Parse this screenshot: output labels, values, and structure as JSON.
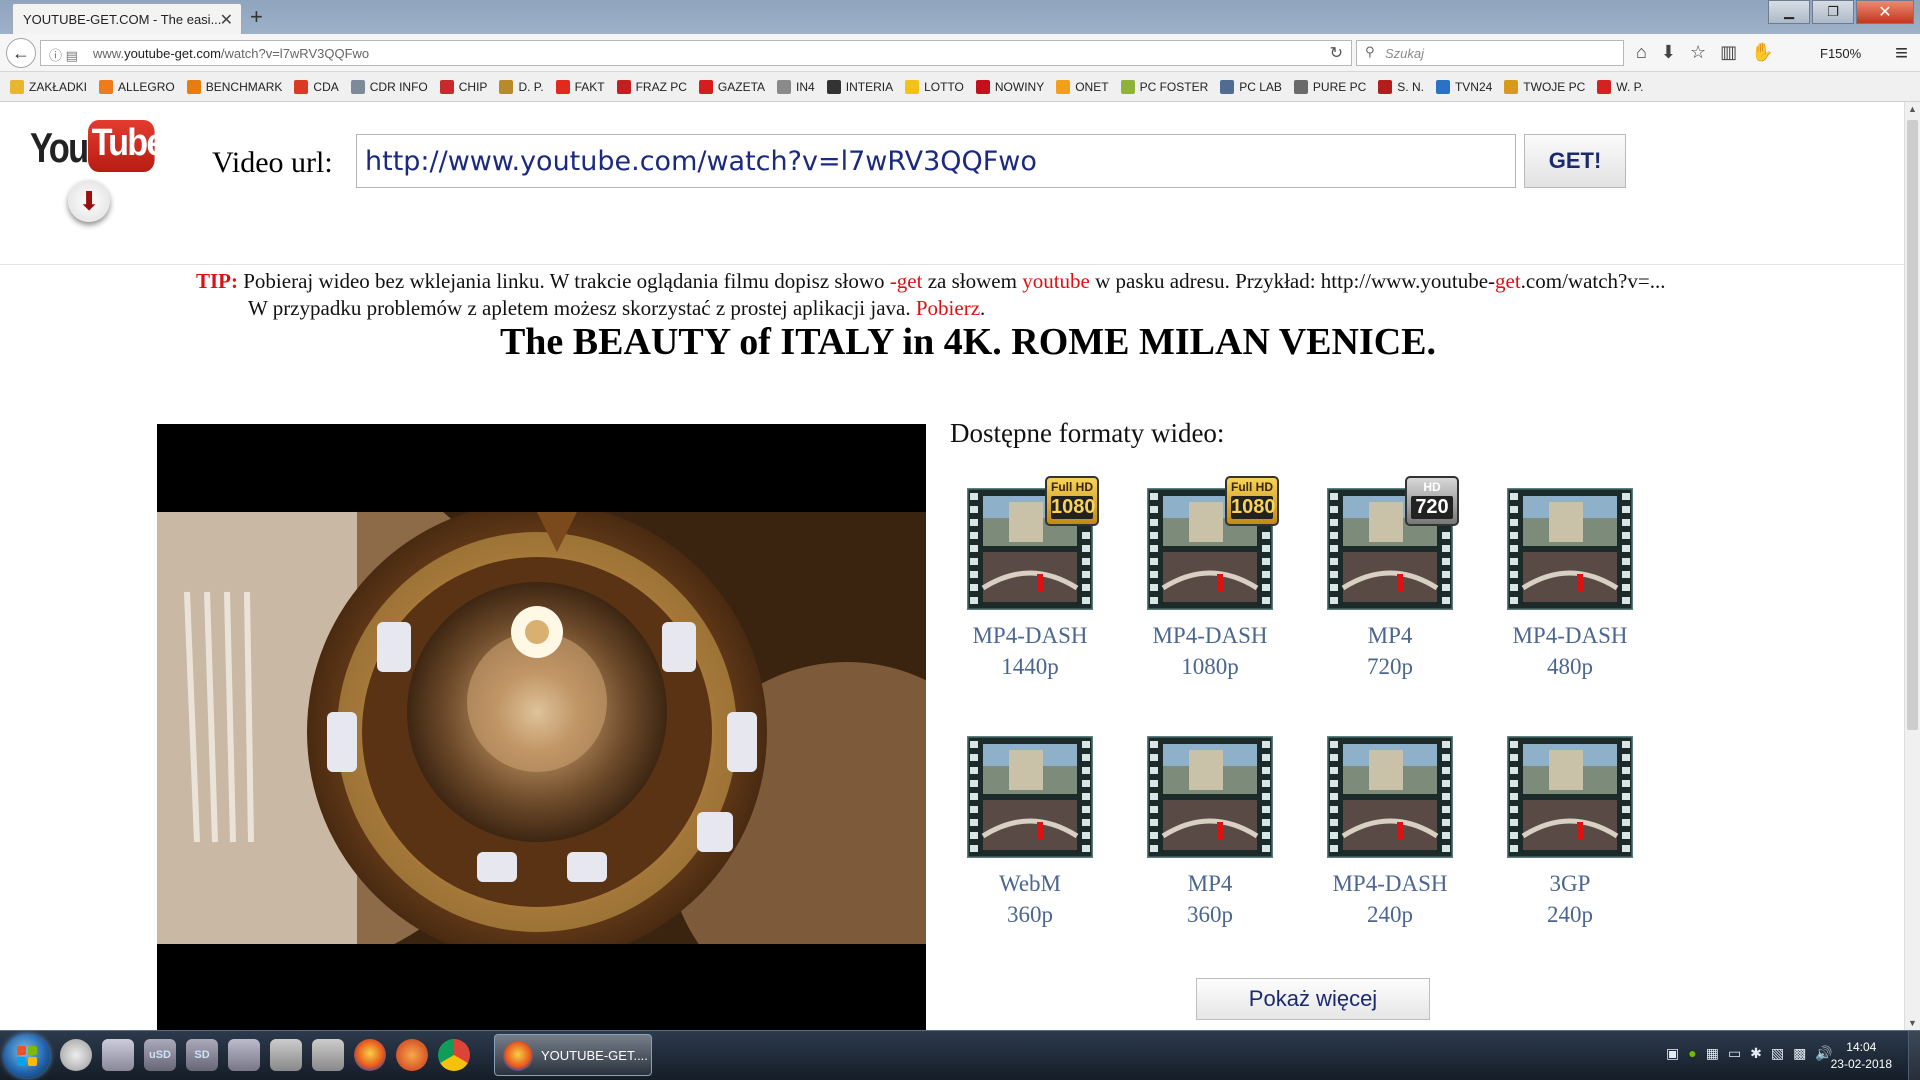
{
  "browser": {
    "tab_title": "YOUTUBE-GET.COM - The easi...",
    "url_prefix": "www.",
    "url_host": "youtube-get.com",
    "url_path": "/watch?v=l7wRV3QQFwo",
    "search_placeholder": "Szukaj",
    "zoom": "F150%"
  },
  "bookmarks": [
    {
      "label": "ZAKŁADKI",
      "color": "#e8b633"
    },
    {
      "label": "ALLEGRO",
      "color": "#f07b1a"
    },
    {
      "label": "BENCHMARK",
      "color": "#e67d13"
    },
    {
      "label": "CDA",
      "color": "#d83b24"
    },
    {
      "label": "CDR INFO",
      "color": "#7c8a99"
    },
    {
      "label": "CHIP",
      "color": "#c62a2a"
    },
    {
      "label": "D. P.",
      "color": "#b98a2c"
    },
    {
      "label": "FAKT",
      "color": "#e12a1d"
    },
    {
      "label": "FRAZ PC",
      "color": "#c02020"
    },
    {
      "label": "GAZETA",
      "color": "#d61d1d"
    },
    {
      "label": "IN4",
      "color": "#8a8a8a"
    },
    {
      "label": "INTERIA",
      "color": "#333333"
    },
    {
      "label": "LOTTO",
      "color": "#f2c21a"
    },
    {
      "label": "NOWINY",
      "color": "#c3101c"
    },
    {
      "label": "ONET",
      "color": "#f2a019"
    },
    {
      "label": "PC FOSTER",
      "color": "#8fb23b"
    },
    {
      "label": "PC LAB",
      "color": "#4f6d93"
    },
    {
      "label": "PURE PC",
      "color": "#6a6a6a"
    },
    {
      "label": "S. N.",
      "color": "#b51c1c"
    },
    {
      "label": "TVN24",
      "color": "#2a72c4"
    },
    {
      "label": "TWOJE PC",
      "color": "#d89a1d"
    },
    {
      "label": "W. P.",
      "color": "#d42121"
    }
  ],
  "form": {
    "label": "Video url:",
    "value": "http://www.youtube.com/watch?v=l7wRV3QQFwo",
    "button": "GET!"
  },
  "tip": {
    "label": "TIP:",
    "l1_a": "Pobieraj wideo bez wklejania linku. W trakcie oglądania filmu dopisz słowo",
    "l1_b": "-get",
    "l1_c": "za słowem",
    "l1_d": "youtube",
    "l1_e": "w pasku adresu. Przykład: http://www.youtube-",
    "l1_f": "get",
    "l1_g": ".com/watch?v=...",
    "l2_a": "W przypadku problemów z apletem możesz skorzystać z prostej aplikacji java.",
    "l2_b": "Pobierz",
    "l2_c": "."
  },
  "video": {
    "title": "The BEAUTY of ITALY in 4K. ROME MILAN VENICE."
  },
  "formats": {
    "heading": "Dostępne formaty wideo:",
    "items": [
      {
        "name": "MP4-DASH",
        "res": "1440p",
        "badge": "fullhd",
        "badge_top": "Full HD",
        "badge_num": "1080"
      },
      {
        "name": "MP4-DASH",
        "res": "1080p",
        "badge": "fullhd",
        "badge_top": "Full HD",
        "badge_num": "1080"
      },
      {
        "name": "MP4",
        "res": "720p",
        "badge": "hd",
        "badge_top": "HD",
        "badge_num": "720"
      },
      {
        "name": "MP4-DASH",
        "res": "480p",
        "badge": "",
        "badge_top": "",
        "badge_num": ""
      },
      {
        "name": "WebM",
        "res": "360p",
        "badge": "",
        "badge_top": "",
        "badge_num": ""
      },
      {
        "name": "MP4",
        "res": "360p",
        "badge": "",
        "badge_top": "",
        "badge_num": ""
      },
      {
        "name": "MP4-DASH",
        "res": "240p",
        "badge": "",
        "badge_top": "",
        "badge_num": ""
      },
      {
        "name": "3GP",
        "res": "240p",
        "badge": "",
        "badge_top": "",
        "badge_num": ""
      }
    ],
    "more_button": "Pokaż więcej"
  },
  "taskbar": {
    "active_task": "YOUTUBE-GET....",
    "quick_labels": [
      "uSD",
      "SD"
    ],
    "time": "14:04",
    "date": "23-02-2018"
  }
}
